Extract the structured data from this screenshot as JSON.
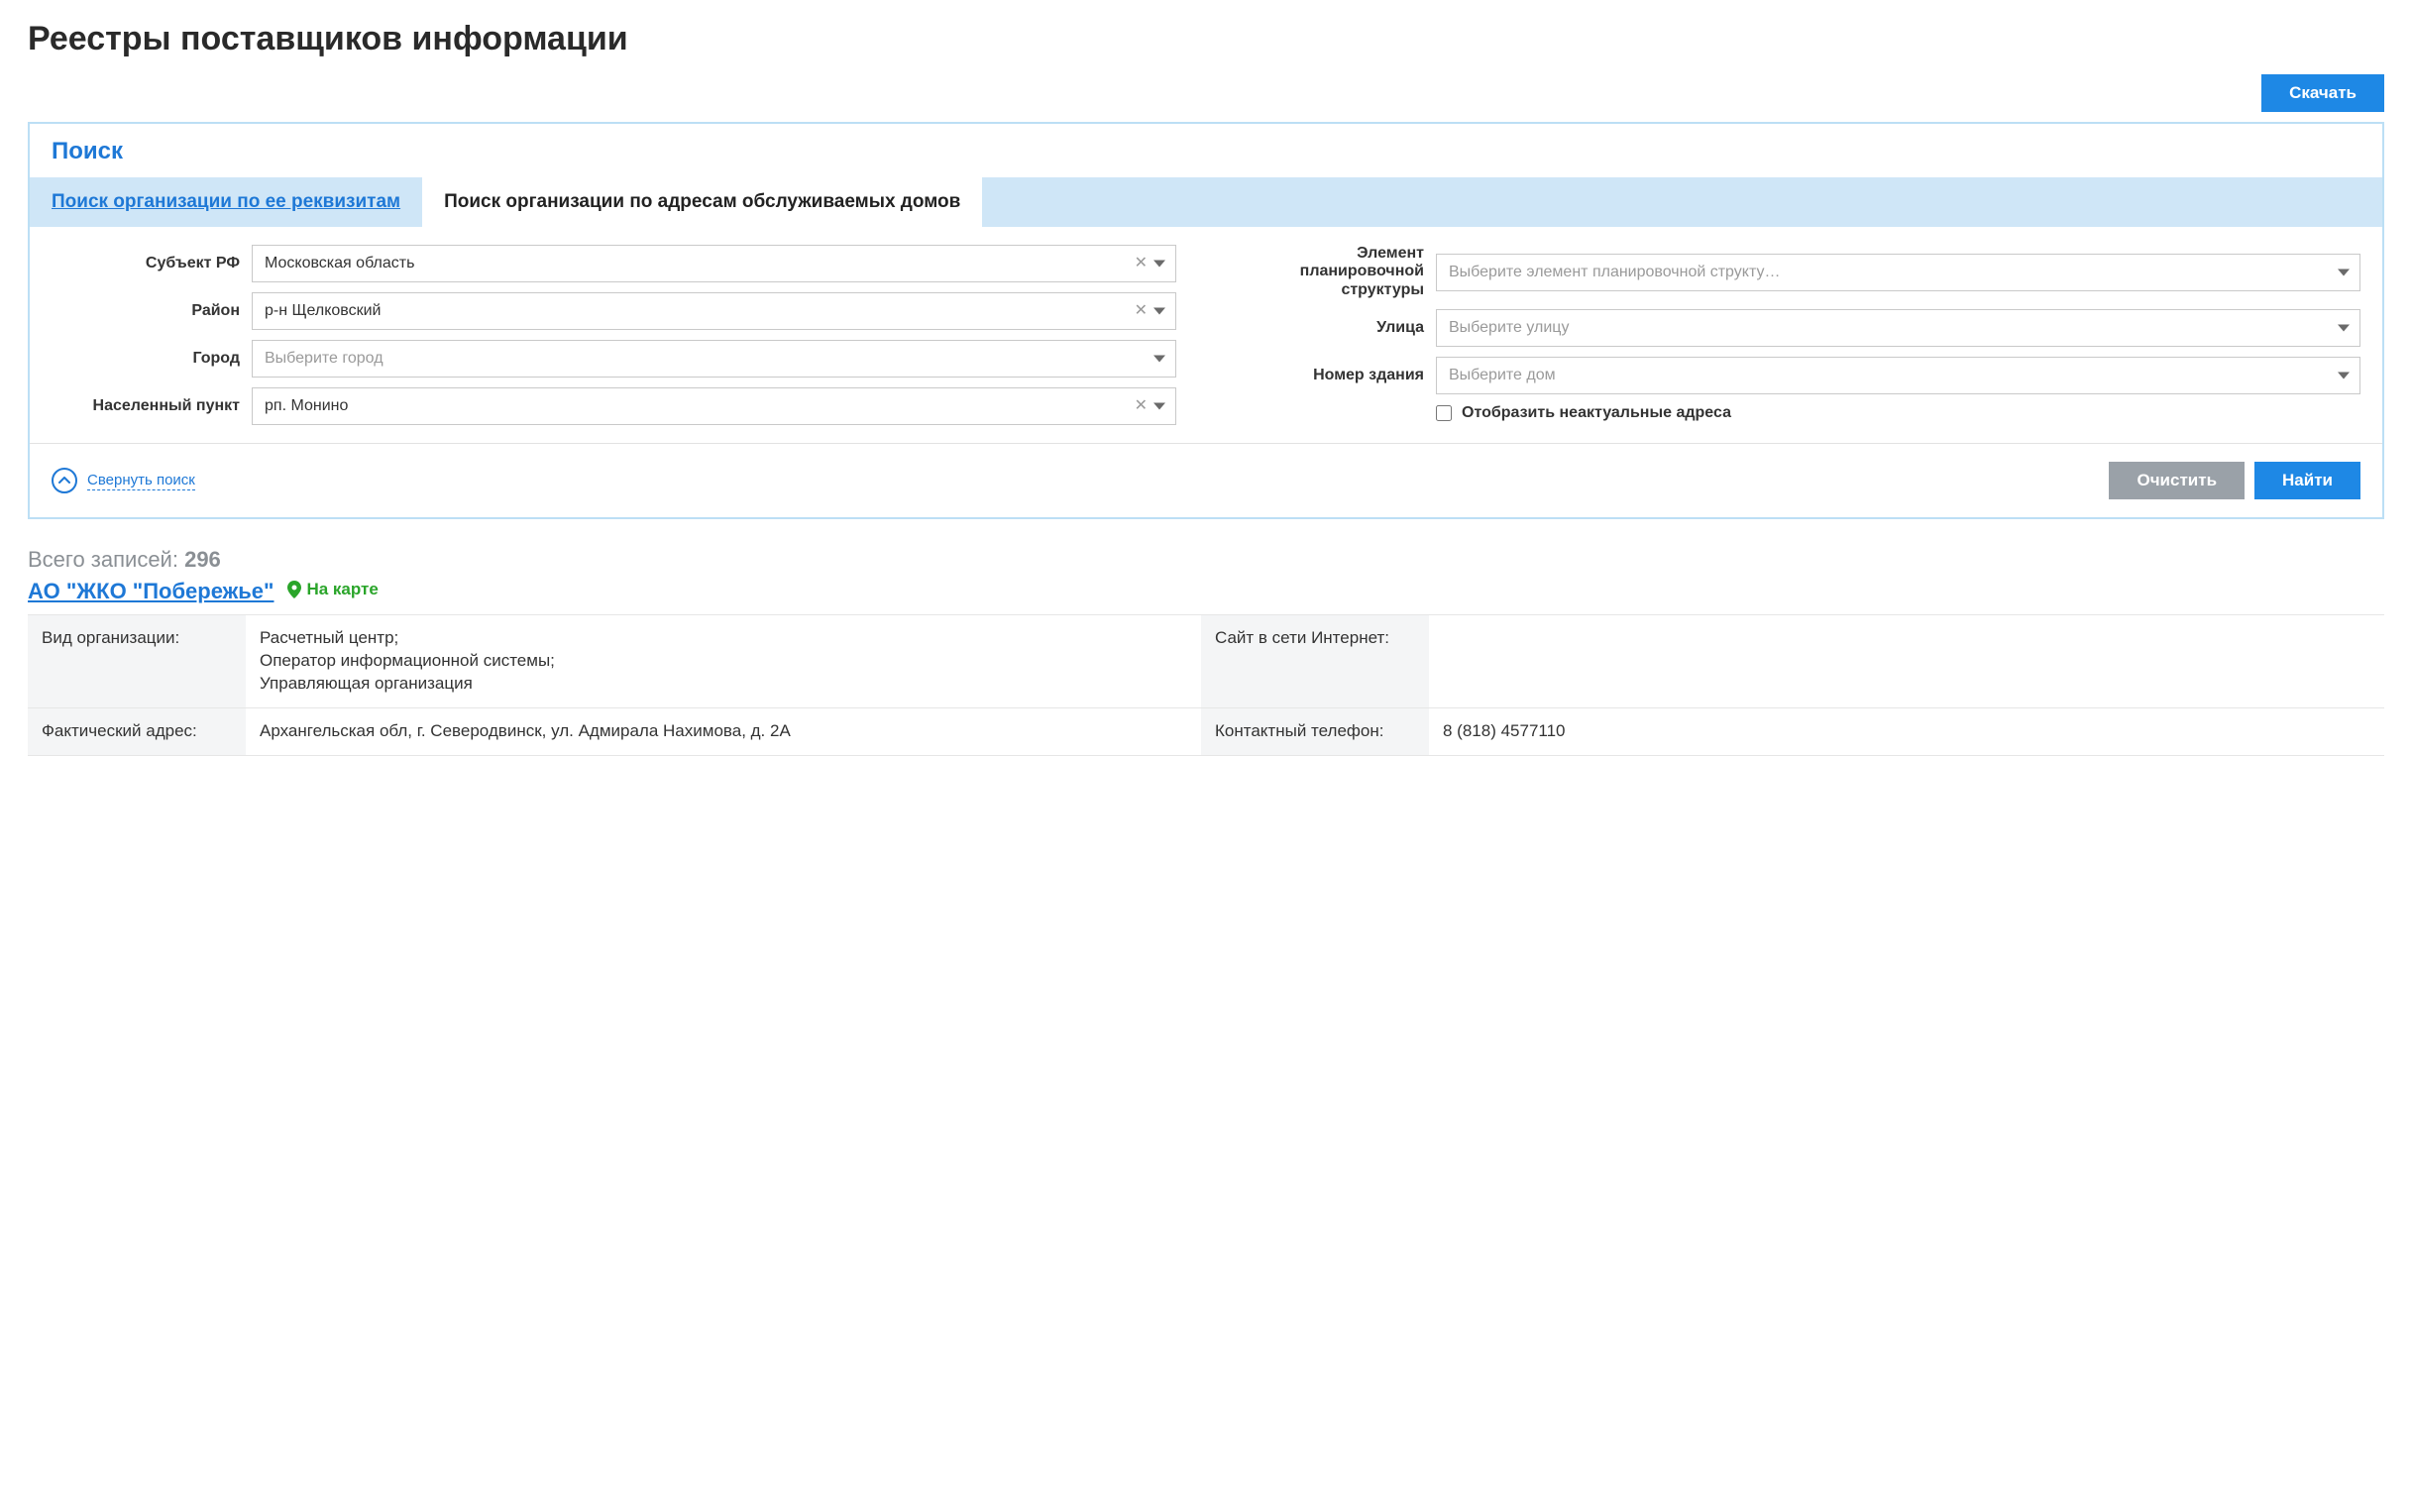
{
  "page_title": "Реестры поставщиков информации",
  "download_label": "Скачать",
  "search": {
    "panel_title": "Поиск",
    "tabs": {
      "by_requisites": "Поиск организации по ее реквизитам",
      "by_address": "Поиск организации по адресам обслуживаемых домов"
    },
    "fields": {
      "subject_label": "Субъект РФ",
      "subject_value": "Московская область",
      "district_label": "Район",
      "district_value": "р-н Щелковский",
      "city_label": "Город",
      "city_placeholder": "Выберите город",
      "settlement_label": "Населенный пункт",
      "settlement_value": "рп. Монино",
      "plan_element_label": "Элемент планировочной структуры",
      "plan_element_placeholder": "Выберите элемент планировочной структу…",
      "street_label": "Улица",
      "street_placeholder": "Выберите улицу",
      "building_label": "Номер здания",
      "building_placeholder": "Выберите дом",
      "show_inactive_label": "Отобразить неактуальные адреса"
    },
    "collapse_label": "Свернуть поиск",
    "clear_label": "Очистить",
    "find_label": "Найти"
  },
  "results": {
    "total_prefix": "Всего записей: ",
    "total_count": "296",
    "org_name": "АО \"ЖКО \"Побережье\"",
    "map_link": "На карте",
    "rows": {
      "org_type_label": "Вид организации:",
      "org_type_value": "Расчетный центр;\nОператор информационной системы;\nУправляющая организация",
      "website_label": "Сайт в сети Интернет:",
      "website_value": "",
      "address_label": "Фактический адрес:",
      "address_value": "Архангельская обл, г. Северодвинск, ул. Адмирала Нахимова, д. 2А",
      "phone_label": "Контактный телефон:",
      "phone_value": "8 (818) 4577110"
    }
  }
}
